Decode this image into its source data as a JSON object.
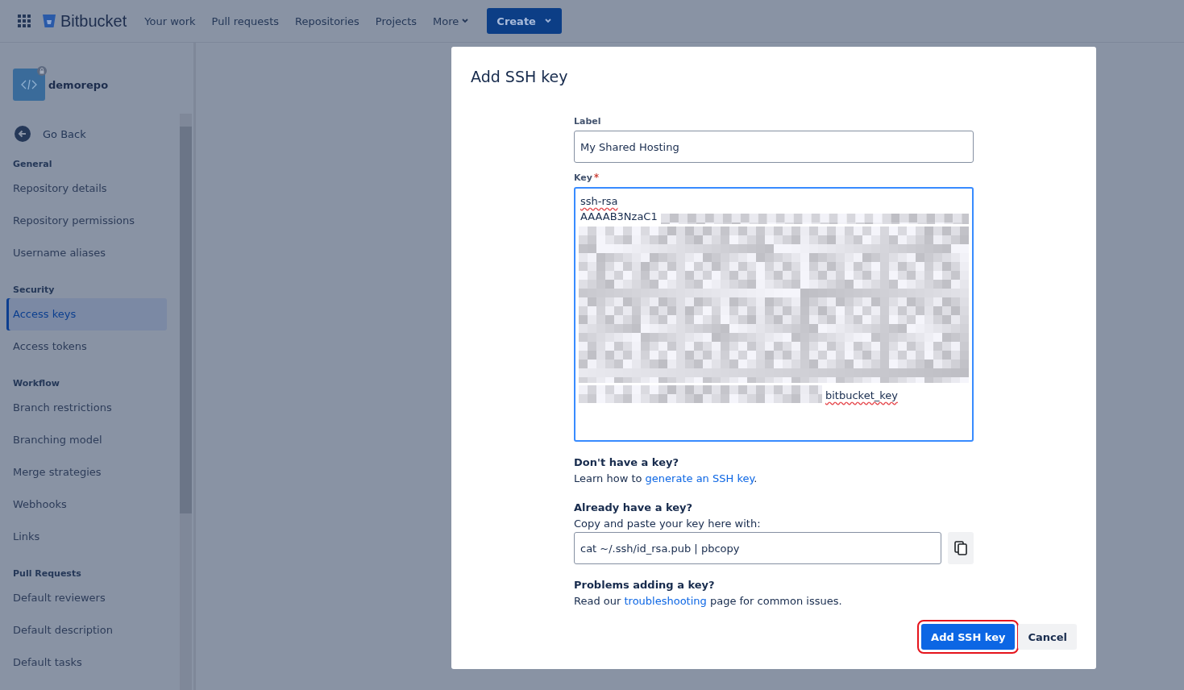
{
  "top_nav": {
    "brand": "Bitbucket",
    "items": [
      {
        "label": "Your work",
        "kind": "link"
      },
      {
        "label": "Pull requests",
        "kind": "link"
      },
      {
        "label": "Repositories",
        "kind": "link"
      },
      {
        "label": "Projects",
        "kind": "link"
      },
      {
        "label": "More",
        "kind": "dropdown"
      }
    ],
    "create_button": "Create"
  },
  "sidebar": {
    "repo_name": "demorepo",
    "back": "Go Back",
    "sections": [
      {
        "heading": "General",
        "items": [
          {
            "label": "Repository details",
            "selected": false
          },
          {
            "label": "Repository permissions",
            "selected": false
          },
          {
            "label": "Username aliases",
            "selected": false
          }
        ]
      },
      {
        "heading": "Security",
        "items": [
          {
            "label": "Access keys",
            "selected": true
          },
          {
            "label": "Access tokens",
            "selected": false
          }
        ]
      },
      {
        "heading": "Workflow",
        "items": [
          {
            "label": "Branch restrictions",
            "selected": false
          },
          {
            "label": "Branching model",
            "selected": false
          },
          {
            "label": "Merge strategies",
            "selected": false
          },
          {
            "label": "Webhooks",
            "selected": false
          },
          {
            "label": "Links",
            "selected": false
          }
        ]
      },
      {
        "heading": "Pull Requests",
        "items": [
          {
            "label": "Default reviewers",
            "selected": false
          },
          {
            "label": "Default description",
            "selected": false
          },
          {
            "label": "Default tasks",
            "selected": false
          }
        ]
      }
    ]
  },
  "dialog": {
    "title": "Add SSH key",
    "label_field": {
      "label": "Label",
      "value": "My Shared Hosting"
    },
    "key_field": {
      "label": "Key",
      "required": true,
      "focused": true,
      "lines": [
        [
          {
            "kind": "text",
            "text": "ssh-rsa",
            "misspelled": true
          }
        ],
        [
          {
            "kind": "text",
            "text": "AAAAB3NzaC1",
            "misspelled": false
          },
          {
            "kind": "redacted"
          }
        ],
        [
          {
            "kind": "redacted_block"
          }
        ],
        [
          {
            "kind": "redacted"
          },
          {
            "kind": "text",
            "text": "bitbucket_key",
            "misspelled": true
          }
        ]
      ]
    },
    "help": [
      {
        "heading": "Don't have a key?",
        "before": "Learn how to ",
        "link": "generate an SSH key",
        "after": "."
      },
      {
        "heading": "Already have a key?",
        "before": "Copy and paste your key here with:",
        "command": "cat ~/.ssh/id_rsa.pub | pbcopy"
      },
      {
        "heading": "Problems adding a key?",
        "before": "Read our ",
        "link": "troubleshooting",
        "after": " page for common issues."
      }
    ],
    "buttons": [
      {
        "label": "Add SSH key",
        "kind": "primary",
        "highlighted": true
      },
      {
        "label": "Cancel",
        "kind": "subtle",
        "highlighted": false
      }
    ]
  }
}
